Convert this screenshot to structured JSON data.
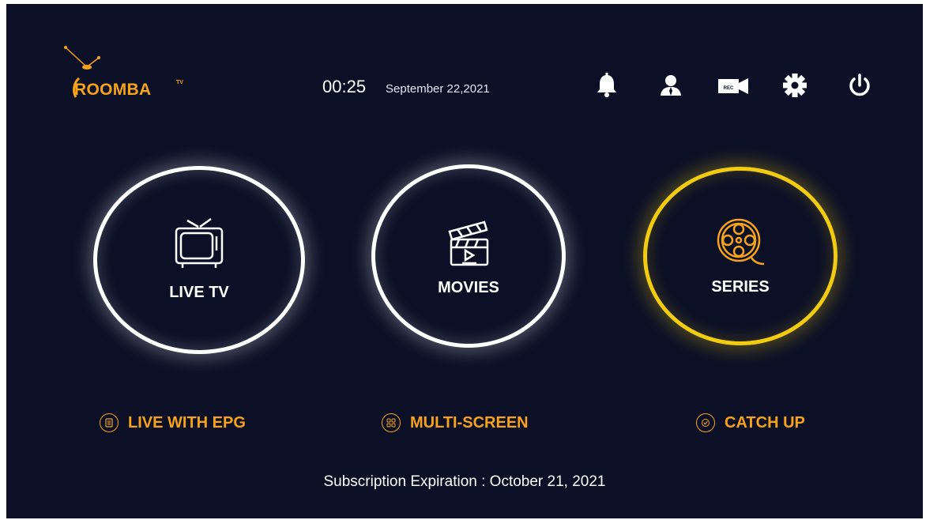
{
  "brand": {
    "name": "ROOMBA",
    "suffix": "TV",
    "color": "#f7a21b"
  },
  "header": {
    "time": "00:25",
    "date": "September 22,2021",
    "icons": [
      "bell-icon",
      "user-icon",
      "record-icon",
      "gear-icon",
      "power-icon"
    ],
    "record_text": "REC"
  },
  "tiles": [
    {
      "label": "LIVE TV",
      "icon": "tv-icon",
      "selected": false
    },
    {
      "label": "MOVIES",
      "icon": "clapperboard-icon",
      "selected": false
    },
    {
      "label": "SERIES",
      "icon": "film-reel-icon",
      "selected": true
    }
  ],
  "shortcuts": [
    {
      "label": "LIVE WITH EPG",
      "icon": "guide-icon"
    },
    {
      "label": "MULTI-SCREEN",
      "icon": "grid-icon"
    },
    {
      "label": "CATCH UP",
      "icon": "check-icon"
    }
  ],
  "subscription": "Subscription Expiration : October 21, 2021",
  "colors": {
    "background": "#0c1026",
    "accent": "#f7a21b",
    "highlight": "#f2cc11"
  }
}
